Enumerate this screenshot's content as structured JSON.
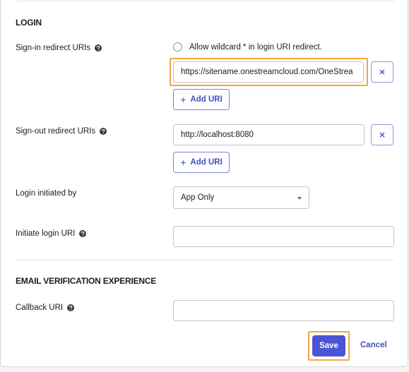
{
  "login_section": {
    "title": "LOGIN",
    "sign_in": {
      "label": "Sign-in redirect URIs",
      "wildcard_label": "Allow wildcard * in login URI redirect.",
      "uri_value": "https://sitename.onestreamcloud.com/OneStrea",
      "add_label": "Add URI"
    },
    "sign_out": {
      "label": "Sign-out redirect URIs",
      "uri_value": "http://localhost:8080",
      "add_label": "Add URI"
    },
    "login_initiated": {
      "label": "Login initiated by",
      "selected": "App Only"
    },
    "initiate_login_uri": {
      "label": "Initiate login URI",
      "value": ""
    }
  },
  "email_section": {
    "title": "EMAIL VERIFICATION EXPERIENCE",
    "callback": {
      "label": "Callback URI",
      "value": ""
    }
  },
  "actions": {
    "save_label": "Save",
    "cancel_label": "Cancel"
  },
  "colors": {
    "accent": "#4a55d4",
    "highlight": "#f5a442"
  },
  "icons": {
    "help": "help-circle-icon",
    "remove": "close-icon",
    "dropdown": "caret-down-icon",
    "add": "plus-icon"
  }
}
